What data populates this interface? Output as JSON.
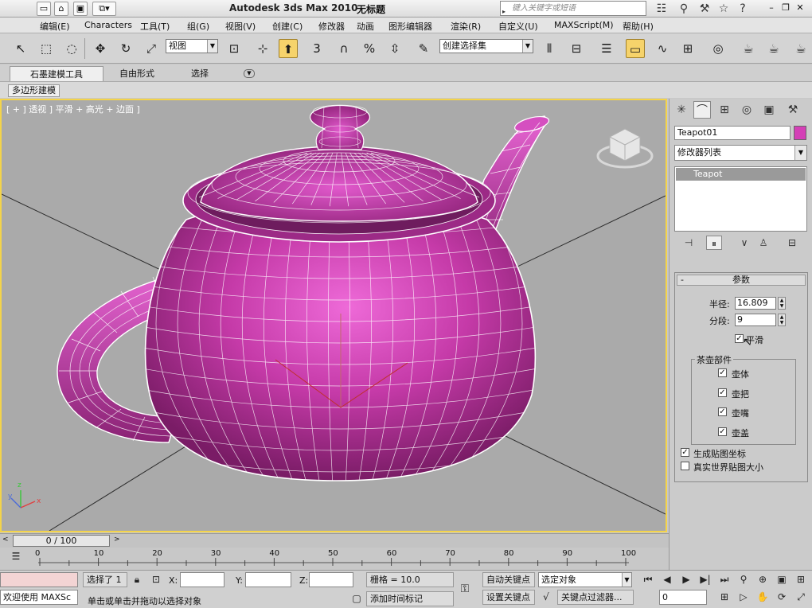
{
  "titlebar": {
    "title": "Autodesk 3ds Max  2010",
    "document": "无标题",
    "search_placeholder": "键入关键字或短语"
  },
  "menu": [
    "编辑(E)",
    "Characters",
    "工具(T)",
    "组(G)",
    "视图(V)",
    "创建(C)",
    "修改器",
    "动画",
    "图形编辑器",
    "渲染(R)",
    "自定义(U)",
    "MAXScript(M)",
    "帮助(H)"
  ],
  "toolbar": {
    "ref_coord": "视图",
    "selection_set": "创建选择集",
    "snap_label": "3",
    "percent_label": "%"
  },
  "ribbon": {
    "tabs": [
      "石墨建模工具",
      "自由形式",
      "选择"
    ],
    "sub_label": "多边形建模"
  },
  "viewport": {
    "label": "[ + ] 透视 ] 平滑 + 高光 + 边面 ]",
    "object_color": "#d43fb6",
    "wire_color": "#ffffff",
    "background": "#aaaaaa",
    "axis_x": "x",
    "axis_y": "y",
    "axis_z": "z"
  },
  "command_panel": {
    "object_name": "Teapot01",
    "modifier_list": "修改器列表",
    "stack_item": "Teapot",
    "rollout_title": "参数",
    "radius_label": "半径:",
    "radius": "16.809",
    "segments_label": "分段:",
    "segments": "9",
    "smooth_label": "平滑",
    "smooth": true,
    "parts_group": "茶壶部件",
    "parts": [
      {
        "label": "壶体",
        "checked": true
      },
      {
        "label": "壶把",
        "checked": true
      },
      {
        "label": "壶嘴",
        "checked": true
      },
      {
        "label": "壶盖",
        "checked": true
      }
    ],
    "gen_mapping_label": "生成贴图坐标",
    "gen_mapping": true,
    "real_world_label": "真实世界贴图大小",
    "real_world": false
  },
  "timeline": {
    "frame_display": "0 / 100",
    "ticks": [
      "0",
      "10",
      "20",
      "30",
      "40",
      "50",
      "60",
      "70",
      "80",
      "90",
      "100"
    ]
  },
  "status": {
    "welcome": "欢迎使用 MAXSc",
    "selected": "选择了 1",
    "x_label": "X:",
    "y_label": "Y:",
    "z_label": "Z:",
    "x_value": "",
    "y_value": "",
    "z_value": "",
    "grid": "栅格 = 10.0",
    "prompt": "单击或单击并拖动以选择对象",
    "add_time_tag": "添加时间标记",
    "auto_key": "自动关键点",
    "set_key": "设置关键点",
    "key_target": "选定对象",
    "key_filters": "关键点过滤器...",
    "frame": "0"
  }
}
